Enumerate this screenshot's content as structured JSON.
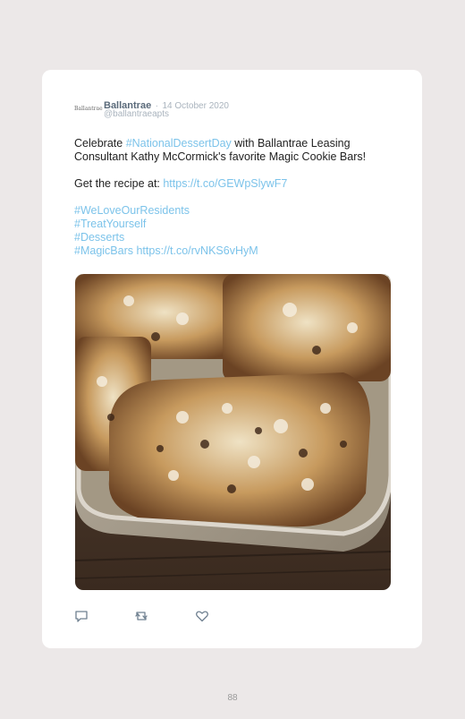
{
  "tweet": {
    "logo_text": "Ballantrae",
    "name": "Ballantrae",
    "separator": "·",
    "date": "14 October 2020",
    "handle": "@ballantraeapts",
    "line1_pre": "Celebrate ",
    "line1_tag": "#NationalDessertDay",
    "line1_post": " with Ballantrae Leasing Consultant Kathy McCormick's favorite Magic Cookie Bars!",
    "recipe_pre": "Get the recipe at: ",
    "recipe_link": "https://t.co/GEWpSlywF7",
    "tags": [
      "#WeLoveOurResidents",
      "#TreatYourself",
      "#Desserts",
      "#MagicBars"
    ],
    "final_link": "https://t.co/rvNKS6vHyM",
    "image_alt": "Magic cookie bars with coconut and chocolate on a baking sheet"
  },
  "actions": {
    "reply_icon": "reply-icon",
    "retweet_icon": "retweet-icon",
    "like_icon": "heart-icon"
  },
  "colors": {
    "link": "#7cc3ea",
    "name": "#5a6a7a",
    "muted": "#aab4be",
    "background": "#ece8e8"
  },
  "page": {
    "number": "88"
  }
}
